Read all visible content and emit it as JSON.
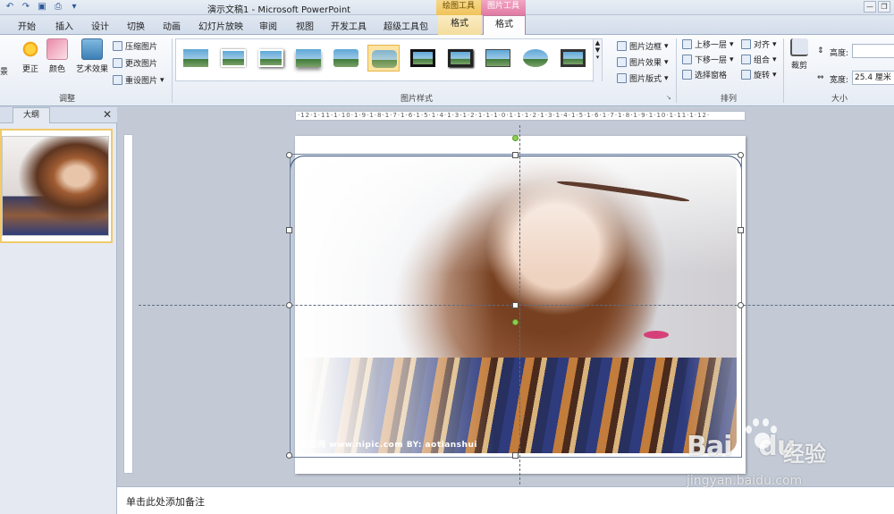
{
  "window": {
    "title": "演示文稿1 - Microsoft PowerPoint",
    "context_tab_drawing": "绘图工具",
    "context_tab_picture": "图片工具",
    "qat_icons": [
      "undo-icon",
      "redo-icon",
      "save-icon",
      "print-icon",
      "customize-icon"
    ],
    "buttons": [
      "minimize",
      "restore"
    ]
  },
  "tabs": {
    "items": [
      "开始",
      "插入",
      "设计",
      "切换",
      "动画",
      "幻灯片放映",
      "审阅",
      "视图",
      "开发工具",
      "超级工具包"
    ],
    "drawing_format": "格式",
    "picture_format": "格式"
  },
  "ribbon": {
    "adjust": {
      "label": "调整",
      "correct": "更正",
      "color": "颜色",
      "artistic": "艺术效果",
      "compress": "压缩图片",
      "change": "更改图片",
      "reset": "重设图片",
      "partial_left": "景"
    },
    "picture_styles": {
      "label": "图片样式",
      "border": "图片边框",
      "effects": "图片效果",
      "layout": "图片版式",
      "thumb_count": 11,
      "selected_index": 5
    },
    "arrange": {
      "label": "排列",
      "bring_forward": "上移一层",
      "send_backward": "下移一层",
      "selection_pane": "选择窗格",
      "align": "对齐",
      "group": "组合",
      "rotate": "旋转"
    },
    "size": {
      "label": "大小",
      "crop": "裁剪",
      "height_label": "高度:",
      "height_value": "",
      "width_label": "宽度:",
      "width_value": "25.4 厘米"
    }
  },
  "left_pane": {
    "outline_tab": "大纲",
    "close": "✕"
  },
  "ruler": {
    "horizontal": "·12·1·11·1·10·1·9·1·8·1·7·1·6·1·5·1·4·1·3·1·2·1·1·1·0·1·1·1·2·1·3·1·4·1·5·1·6·1·7·1·8·1·9·1·10·1·11·1·12·"
  },
  "slide": {
    "watermark": "昵图网 www.nipic.com    BY: aotianshui"
  },
  "notes": {
    "placeholder": "单击此处添加备注"
  },
  "overlay": {
    "logo_text": "Bai",
    "logo_text2": "du",
    "cn_text": "经验",
    "url": "jingyan.baidu.com"
  }
}
